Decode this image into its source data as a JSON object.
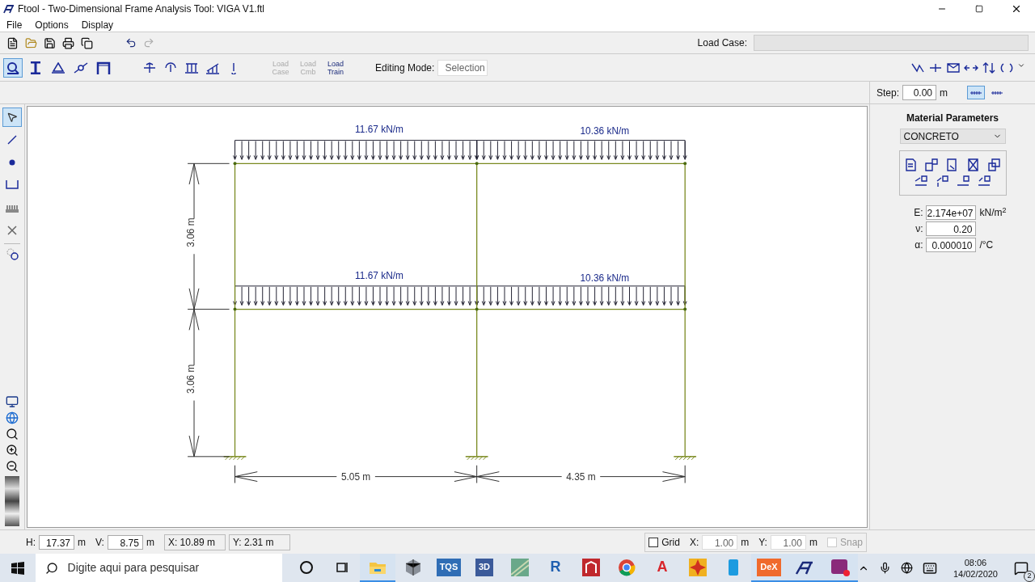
{
  "window": {
    "title": "Ftool - Two-Dimensional Frame Analysis Tool: VIGA V1.ftl"
  },
  "menu": [
    "File",
    "Options",
    "Display"
  ],
  "toolbar": {
    "load_buttons": [
      {
        "label": "Load Case",
        "disabled": true
      },
      {
        "label": "Load Cmb",
        "disabled": true
      },
      {
        "label": "Load Train",
        "disabled": false
      }
    ],
    "tools": [
      {
        "kind": "frame",
        "selected": true
      },
      {
        "kind": "section",
        "selected": false
      },
      {
        "kind": "support",
        "selected": false
      },
      {
        "kind": "hinge",
        "selected": false
      },
      {
        "kind": "portal",
        "selected": false
      }
    ],
    "editing_mode": {
      "label": "Editing Mode:",
      "value": "Selection"
    },
    "load_case_label": "Load Case:"
  },
  "step": {
    "label": "Step:",
    "value": "0.00",
    "unit": "m"
  },
  "left_tools": [
    {
      "kind": "pointer",
      "selected": true
    },
    {
      "kind": "line",
      "selected": false
    },
    {
      "kind": "node",
      "selected": false
    },
    {
      "kind": "dimension",
      "selected": false
    },
    {
      "kind": "hatch",
      "selected": false
    },
    {
      "kind": "cross",
      "selected": false
    }
  ],
  "frame": {
    "loads": [
      {
        "label": "11.67 kN/m"
      },
      {
        "label": "10.36 kN/m"
      },
      {
        "label": "11.67 kN/m"
      },
      {
        "label": "10.36 kN/m"
      }
    ],
    "heights": [
      "3.06 m",
      "3.06 m"
    ],
    "spans": [
      "5.05 m",
      "4.35 m"
    ]
  },
  "material": {
    "title": "Material Parameters",
    "selected": "CONCRETO",
    "params": [
      {
        "symbol": "E:",
        "value": "2.174e+07",
        "unit": "kN/m$^{2}$"
      },
      {
        "symbol": "ν:",
        "value": "0.20"
      },
      {
        "symbol": "α:",
        "value": "0.000010",
        "unit": "/°C"
      }
    ]
  },
  "status": {
    "h": {
      "label": "H:",
      "value": "17.37",
      "unit": "m"
    },
    "v": {
      "label": "V:",
      "value": "8.75",
      "unit": "m"
    },
    "x": "X: 10.89 m",
    "y": "Y: 2.31 m",
    "grid": {
      "label": "Grid",
      "checked": false
    },
    "gx": {
      "label": "X:",
      "value": "1.00",
      "unit": "m"
    },
    "gy": {
      "label": "Y:",
      "value": "1.00",
      "unit": "m"
    },
    "snap": {
      "label": "Snap",
      "checked": false,
      "disabled": true
    }
  },
  "taskbar": {
    "search_placeholder": "Digite aqui para pesquisar",
    "apps": [
      {
        "kind": "cortana"
      },
      {
        "kind": "taskview"
      },
      {
        "kind": "folder",
        "active": true
      },
      {
        "kind": "cube"
      },
      {
        "kind": "tile",
        "label": "TQS",
        "color": "#2f6db5"
      },
      {
        "kind": "tile",
        "label": "3D",
        "color": "#3b5a9a"
      },
      {
        "kind": "map"
      },
      {
        "kind": "letter",
        "label": "R",
        "color": "#1f5fb0"
      },
      {
        "kind": "app",
        "color": "#c0282d"
      },
      {
        "kind": "chrome"
      },
      {
        "kind": "letter",
        "label": "A",
        "color": "#d8262c"
      },
      {
        "kind": "star"
      },
      {
        "kind": "phone"
      },
      {
        "kind": "tile",
        "label": "DeX",
        "color": "#f06a2c",
        "active": true
      },
      {
        "kind": "ftool",
        "active": true
      },
      {
        "kind": "video",
        "active": true
      }
    ],
    "time": "08:06",
    "date": "14/02/2020",
    "notifications": "2"
  }
}
